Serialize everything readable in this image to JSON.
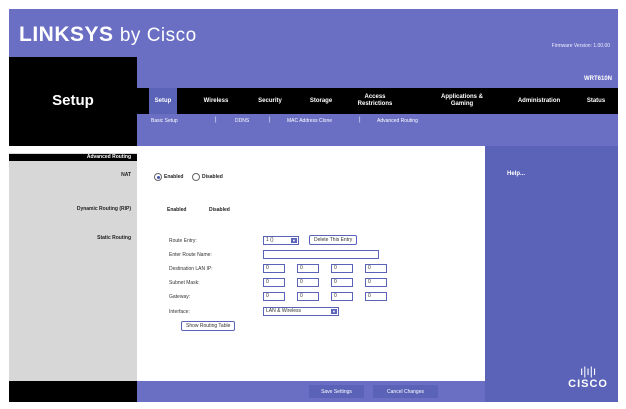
{
  "header": {
    "brand": "LINKSYS",
    "brand_suffix": "by Cisco",
    "firmware": "Firmware Version: 1.00.00"
  },
  "product": {
    "model": "WRT610N"
  },
  "left": {
    "section_title": "Setup",
    "advanced_routing": "Advanced Routing",
    "nat": "NAT",
    "dynamic_routing": "Dynamic Routing (RIP)",
    "static_routing": "Static Routing"
  },
  "nav": {
    "tabs": [
      {
        "label": "Setup"
      },
      {
        "label": "Wireless"
      },
      {
        "label": "Security"
      },
      {
        "label": "Storage"
      },
      {
        "label": "Access Restrictions"
      },
      {
        "label": "Applications & Gaming"
      },
      {
        "label": "Administration"
      },
      {
        "label": "Status"
      }
    ],
    "subtabs": [
      {
        "label": "Basic Setup"
      },
      {
        "label": "DDNS"
      },
      {
        "label": "MAC Address Clone"
      },
      {
        "label": "Advanced Routing"
      }
    ]
  },
  "form": {
    "nat_enabled": "Enabled",
    "nat_disabled": "Disabled",
    "rip_enabled": "Enabled",
    "rip_disabled": "Disabled",
    "route_entry_label": "Route Entry:",
    "route_entry_value": "1 ()",
    "delete_entry": "Delete This Entry",
    "route_name_label": "Enter Route Name:",
    "dest_ip_label": "Destination LAN IP:",
    "dest_ip": [
      "0",
      "0",
      "0",
      "0"
    ],
    "subnet_label": "Subnet Mask:",
    "subnet": [
      "0",
      "0",
      "0",
      "0"
    ],
    "gateway_label": "Gateway:",
    "gateway": [
      "0",
      "0",
      "0",
      "0"
    ],
    "interface_label": "Interface:",
    "interface_value": "LAN & Wireless",
    "show_table": "Show Routing Table"
  },
  "help": {
    "title": "Help..."
  },
  "footer": {
    "save": "Save Settings",
    "cancel": "Cancel Changes"
  },
  "cisco": {
    "text": "CISCO"
  }
}
